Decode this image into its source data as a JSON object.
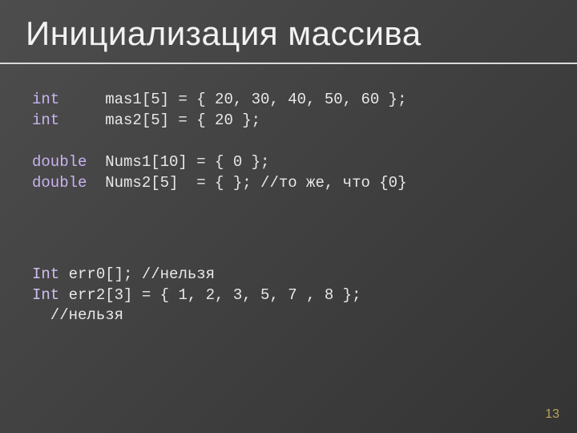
{
  "colors": {
    "keyword": "#c9b3f0"
  },
  "title": "Инициализация массива",
  "code": {
    "line1_kw": "int",
    "line1_rest": "\tmas1[5] = { 20, 30, 40, 50, 60 };",
    "line2_kw": "int",
    "line2_rest": "\tmas2[5] = { 20 };",
    "line3_kw": "double",
    "line3_rest": "\tNums1[10] = { 0 };",
    "line4_kw": "double",
    "line4_rest": "\tNums2[5]  = { }; //то же, что {0}",
    "line5_kw": "Int",
    "line5_rest": " err0[]; //нельзя",
    "line6_kw": "Int",
    "line6_rest": " err2[3] = { 1, 2, 3, 5, 7 , 8 }; ",
    "line7": "  //нельзя"
  },
  "page_number": "13"
}
